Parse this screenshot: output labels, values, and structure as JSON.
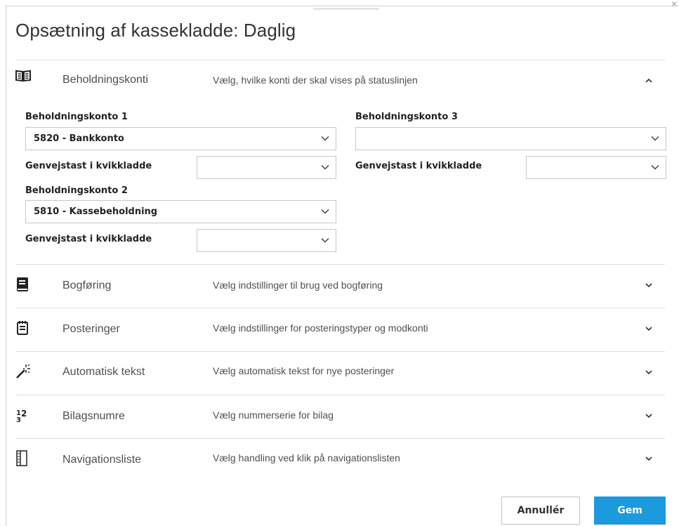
{
  "dialog": {
    "title": "Opsætning af kassekladde: Daglig",
    "close_label": "×"
  },
  "sections": [
    {
      "name": "Beholdningskonti",
      "description": "Vælg, hvilke konti der skal vises på statuslinjen",
      "icon": "book-icon",
      "expanded": true
    },
    {
      "name": "Bogføring",
      "description": "Vælg indstillinger til brug ved bogføring",
      "icon": "ledger-icon",
      "expanded": false
    },
    {
      "name": "Posteringer",
      "description": "Vælg indstillinger for posteringstyper og modkonti",
      "icon": "notepad-icon",
      "expanded": false
    },
    {
      "name": "Automatisk tekst",
      "description": "Vælg automatisk tekst for nye posteringer",
      "icon": "magic-wand-icon",
      "expanded": false
    },
    {
      "name": "Bilagsnumre",
      "description": "Vælg nummerserie for bilag",
      "icon": "numbers-icon",
      "expanded": false
    },
    {
      "name": "Navigationsliste",
      "description": "Vælg handling ved klik på navigationslisten",
      "icon": "list-panel-icon",
      "expanded": false
    }
  ],
  "accounts": {
    "account1": {
      "label": "Beholdningskonto 1",
      "value": "5820 - Bankkonto",
      "shortcut_label": "Genvejstast i kvikkladde",
      "shortcut_value": ""
    },
    "account2": {
      "label": "Beholdningskonto 2",
      "value": "5810 - Kassebeholdning",
      "shortcut_label": "Genvejstast i kvikkladde",
      "shortcut_value": ""
    },
    "account3": {
      "label": "Beholdningskonto 3",
      "value": "",
      "shortcut_label": "Genvejstast i kvikkladde",
      "shortcut_value": ""
    }
  },
  "buttons": {
    "cancel": "Annullér",
    "save": "Gem"
  },
  "colors": {
    "primary": "#1b9ade",
    "divider": "#dedede",
    "field_border": "#c8c8c8"
  }
}
